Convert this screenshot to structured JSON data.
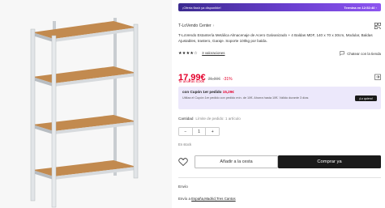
{
  "flash": {
    "label": "¡Oferta flash ya disponible!",
    "timer": "Termina en 12:52:40",
    "arrow": "›"
  },
  "store": {
    "name": "T-LoVendo Center",
    "chevron": "›"
  },
  "product": {
    "title": "T-LoVendo Estantería Metálica Almacenaje de Acero Galvanizado + 4 Baldas MDF, 140 x 70 x 30cm, Modular, Baldas Ajustables, trastero, Garaje. Soporte 100kg por balda."
  },
  "rating": {
    "stars": "★★★★☆",
    "count_label": "3 valoraciones",
    "chat_label": "Chatear con la tienda"
  },
  "price": {
    "current": "17,99€",
    "old": "25,99€",
    "discount": "-31%",
    "savings": "Te ahorras 8,00€"
  },
  "coupon": {
    "title": "con Cupón 1er pedido",
    "amount": "15,29€",
    "desc": "Utiliza el Cupón 1er pedido con pedido mín. de 10€. Ahorra hasta 10€. Válido durante 3 días",
    "button": "¡Lo quiero!"
  },
  "quantity": {
    "label": "Cantidad",
    "limit": "Límite de pedido: 1 artículo",
    "minus": "−",
    "value": "1",
    "plus": "+",
    "stock": "En stock"
  },
  "actions": {
    "add_to_cart": "Añadir a la cesta",
    "buy_now": "Comprar ya"
  },
  "shipping": {
    "heading": "Envío",
    "prefix": "Envío a",
    "location": "España,Madrid,Tres Cantos"
  },
  "colors": {
    "price_red": "#e4002b",
    "flash_purple": "#6a3fd0",
    "coupon_bg": "#ece8fb",
    "buy_black": "#1a1a1a"
  },
  "icons": {
    "qr": "qr-code-icon",
    "chat": "chat-icon",
    "share": "share-icon",
    "favorite": "heart-icon"
  }
}
